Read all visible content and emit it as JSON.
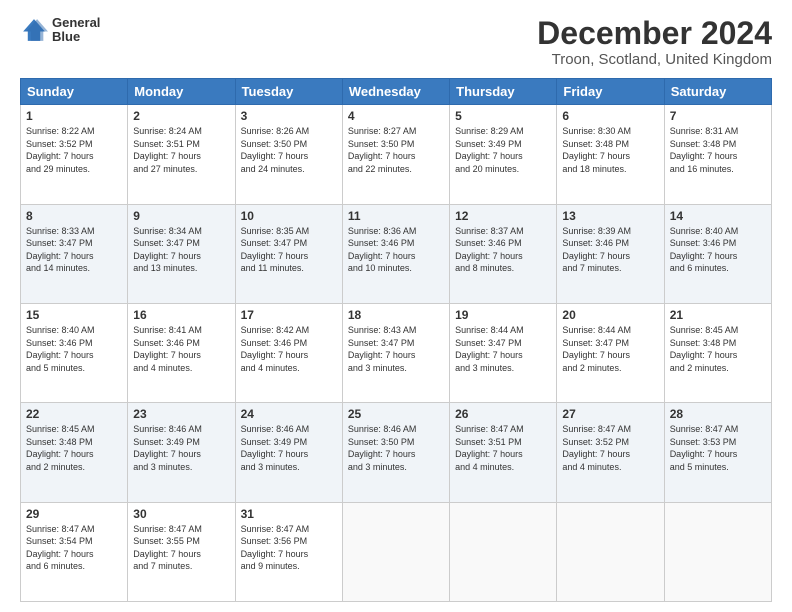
{
  "logo": {
    "line1": "General",
    "line2": "Blue"
  },
  "title": "December 2024",
  "subtitle": "Troon, Scotland, United Kingdom",
  "days_header": [
    "Sunday",
    "Monday",
    "Tuesday",
    "Wednesday",
    "Thursday",
    "Friday",
    "Saturday"
  ],
  "weeks": [
    [
      {
        "day": "1",
        "sunrise": "8:22 AM",
        "sunset": "3:52 PM",
        "daylight_h": "7",
        "daylight_m": "29"
      },
      {
        "day": "2",
        "sunrise": "8:24 AM",
        "sunset": "3:51 PM",
        "daylight_h": "7",
        "daylight_m": "27"
      },
      {
        "day": "3",
        "sunrise": "8:26 AM",
        "sunset": "3:50 PM",
        "daylight_h": "7",
        "daylight_m": "24"
      },
      {
        "day": "4",
        "sunrise": "8:27 AM",
        "sunset": "3:50 PM",
        "daylight_h": "7",
        "daylight_m": "22"
      },
      {
        "day": "5",
        "sunrise": "8:29 AM",
        "sunset": "3:49 PM",
        "daylight_h": "7",
        "daylight_m": "20"
      },
      {
        "day": "6",
        "sunrise": "8:30 AM",
        "sunset": "3:48 PM",
        "daylight_h": "7",
        "daylight_m": "18"
      },
      {
        "day": "7",
        "sunrise": "8:31 AM",
        "sunset": "3:48 PM",
        "daylight_h": "7",
        "daylight_m": "16"
      }
    ],
    [
      {
        "day": "8",
        "sunrise": "8:33 AM",
        "sunset": "3:47 PM",
        "daylight_h": "7",
        "daylight_m": "14"
      },
      {
        "day": "9",
        "sunrise": "8:34 AM",
        "sunset": "3:47 PM",
        "daylight_h": "7",
        "daylight_m": "13"
      },
      {
        "day": "10",
        "sunrise": "8:35 AM",
        "sunset": "3:47 PM",
        "daylight_h": "7",
        "daylight_m": "11"
      },
      {
        "day": "11",
        "sunrise": "8:36 AM",
        "sunset": "3:46 PM",
        "daylight_h": "7",
        "daylight_m": "10"
      },
      {
        "day": "12",
        "sunrise": "8:37 AM",
        "sunset": "3:46 PM",
        "daylight_h": "7",
        "daylight_m": "8"
      },
      {
        "day": "13",
        "sunrise": "8:39 AM",
        "sunset": "3:46 PM",
        "daylight_h": "7",
        "daylight_m": "7"
      },
      {
        "day": "14",
        "sunrise": "8:40 AM",
        "sunset": "3:46 PM",
        "daylight_h": "7",
        "daylight_m": "6"
      }
    ],
    [
      {
        "day": "15",
        "sunrise": "8:40 AM",
        "sunset": "3:46 PM",
        "daylight_h": "7",
        "daylight_m": "5"
      },
      {
        "day": "16",
        "sunrise": "8:41 AM",
        "sunset": "3:46 PM",
        "daylight_h": "7",
        "daylight_m": "4"
      },
      {
        "day": "17",
        "sunrise": "8:42 AM",
        "sunset": "3:46 PM",
        "daylight_h": "7",
        "daylight_m": "4"
      },
      {
        "day": "18",
        "sunrise": "8:43 AM",
        "sunset": "3:47 PM",
        "daylight_h": "7",
        "daylight_m": "3"
      },
      {
        "day": "19",
        "sunrise": "8:44 AM",
        "sunset": "3:47 PM",
        "daylight_h": "7",
        "daylight_m": "3"
      },
      {
        "day": "20",
        "sunrise": "8:44 AM",
        "sunset": "3:47 PM",
        "daylight_h": "7",
        "daylight_m": "2"
      },
      {
        "day": "21",
        "sunrise": "8:45 AM",
        "sunset": "3:48 PM",
        "daylight_h": "7",
        "daylight_m": "2"
      }
    ],
    [
      {
        "day": "22",
        "sunrise": "8:45 AM",
        "sunset": "3:48 PM",
        "daylight_h": "7",
        "daylight_m": "2"
      },
      {
        "day": "23",
        "sunrise": "8:46 AM",
        "sunset": "3:49 PM",
        "daylight_h": "7",
        "daylight_m": "3"
      },
      {
        "day": "24",
        "sunrise": "8:46 AM",
        "sunset": "3:49 PM",
        "daylight_h": "7",
        "daylight_m": "3"
      },
      {
        "day": "25",
        "sunrise": "8:46 AM",
        "sunset": "3:50 PM",
        "daylight_h": "7",
        "daylight_m": "3"
      },
      {
        "day": "26",
        "sunrise": "8:47 AM",
        "sunset": "3:51 PM",
        "daylight_h": "7",
        "daylight_m": "4"
      },
      {
        "day": "27",
        "sunrise": "8:47 AM",
        "sunset": "3:52 PM",
        "daylight_h": "7",
        "daylight_m": "4"
      },
      {
        "day": "28",
        "sunrise": "8:47 AM",
        "sunset": "3:53 PM",
        "daylight_h": "7",
        "daylight_m": "5"
      }
    ],
    [
      {
        "day": "29",
        "sunrise": "8:47 AM",
        "sunset": "3:54 PM",
        "daylight_h": "7",
        "daylight_m": "6"
      },
      {
        "day": "30",
        "sunrise": "8:47 AM",
        "sunset": "3:55 PM",
        "daylight_h": "7",
        "daylight_m": "7"
      },
      {
        "day": "31",
        "sunrise": "8:47 AM",
        "sunset": "3:56 PM",
        "daylight_h": "7",
        "daylight_m": "9"
      },
      null,
      null,
      null,
      null
    ]
  ]
}
